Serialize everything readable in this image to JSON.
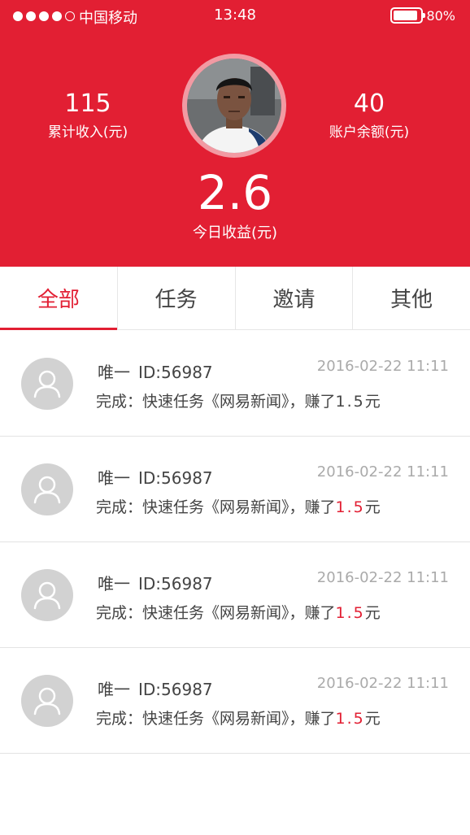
{
  "status_bar": {
    "carrier": "中国移动",
    "time": "13:48",
    "battery": "80%",
    "signal_dots": 5,
    "signal_filled": 4
  },
  "colors": {
    "brand_red": "#e21f33",
    "text": "#444444",
    "muted": "#aaaaaa"
  },
  "header": {
    "total_income_value": "115",
    "total_income_label": "累计收入(元)",
    "balance_value": "40",
    "balance_label": "账户余额(元)",
    "today_value": "2.6",
    "today_label": "今日收益(元)",
    "avatar_icon": "user-photo-avatar"
  },
  "tabs": [
    {
      "label": "全部",
      "active": true
    },
    {
      "label": "任务",
      "active": false
    },
    {
      "label": "邀请",
      "active": false
    },
    {
      "label": "其他",
      "active": false
    }
  ],
  "records": [
    {
      "name": "唯一",
      "uid": "ID:56987",
      "time": "2016-02-22 11:11",
      "text": "完成：快速任务《网易新闻》，赚了",
      "amount": "1.5",
      "unit": "元",
      "amount_highlight": false
    },
    {
      "name": "唯一",
      "uid": "ID:56987",
      "time": "2016-02-22 11:11",
      "text": "完成：快速任务《网易新闻》，赚了",
      "amount": "1.5",
      "unit": "元",
      "amount_highlight": true
    },
    {
      "name": "唯一",
      "uid": "ID:56987",
      "time": "2016-02-22 11:11",
      "text": "完成：快速任务《网易新闻》，赚了",
      "amount": "1.5",
      "unit": "元",
      "amount_highlight": true
    },
    {
      "name": "唯一",
      "uid": "ID:56987",
      "time": "2016-02-22 11:11",
      "text": "完成：快速任务《网易新闻》，赚了",
      "amount": "1.5",
      "unit": "元",
      "amount_highlight": true
    }
  ]
}
